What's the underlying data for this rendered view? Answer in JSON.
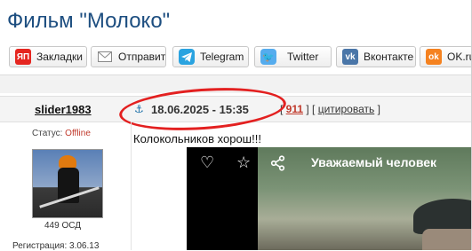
{
  "page": {
    "title": "Фильм \"Молоко\""
  },
  "share": {
    "buttons": [
      {
        "label": "Закладки",
        "icon": "yandex-bookmarks-icon",
        "icon_text": "ЯП",
        "color": "#e52620"
      },
      {
        "label": "Отправить",
        "icon": "mail-icon",
        "color": "#888888"
      },
      {
        "label": "Telegram",
        "icon": "telegram-icon",
        "color": "#2aa3e0"
      },
      {
        "label": "Twitter",
        "icon": "twitter-icon",
        "color": "#55acee"
      },
      {
        "label": "Вконтакте",
        "icon": "vk-icon",
        "icon_text": "vk",
        "color": "#4a76a8"
      },
      {
        "label": "OK.ru",
        "icon": "ok-icon",
        "icon_text": "ok",
        "color": "#f58220"
      }
    ]
  },
  "post": {
    "author": "slider1983",
    "date": "18.06.2025 - 15:35",
    "number": "911",
    "quote_label": "цитировать",
    "status_label": "Статус: ",
    "status_value": "Offline",
    "points": "449 ОСД",
    "registration": "Регистрация: 3.06.13",
    "text": "Колокольников хорош!!!",
    "video_title": "Уважаемый человек"
  },
  "colors": {
    "title": "#1d4e80",
    "highlight_oval": "#e32020",
    "offline": "#c0392b"
  }
}
